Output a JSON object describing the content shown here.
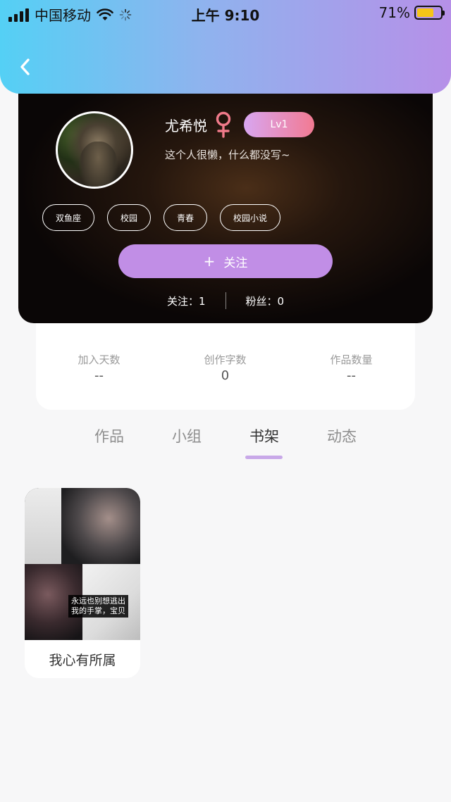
{
  "status_bar": {
    "carrier": "中国移动",
    "time": "上午 9:10",
    "battery_pct_text": "71%",
    "battery_level": 0.71
  },
  "profile": {
    "name": "尤希悦",
    "gender": "female",
    "level": "Lv1",
    "bio": "这个人很懒，什么都没写~",
    "tags": [
      "双鱼座",
      "校园",
      "青春",
      "校园小说"
    ],
    "follow_button": {
      "icon": "+",
      "label": "关注"
    },
    "following": "关注：1",
    "followers": "粉丝：0"
  },
  "stats": [
    {
      "label": "加入天数",
      "value": "--"
    },
    {
      "label": "创作字数",
      "value": "0"
    },
    {
      "label": "作品数量",
      "value": "--"
    }
  ],
  "tabs": [
    {
      "label": "作品",
      "active": false
    },
    {
      "label": "小组",
      "active": false
    },
    {
      "label": "书架",
      "active": true
    },
    {
      "label": "动态",
      "active": false
    }
  ],
  "bookshelf": [
    {
      "title": "我心有所属",
      "cover_caption_line1": "永远也别想逃出",
      "cover_caption_line2": "我的手掌，宝贝"
    }
  ],
  "colors": {
    "header_gradient_start": "#54d0f5",
    "header_gradient_end": "#b690e8",
    "follow_button": "#c18ee6",
    "level_badge_start": "#d8a6f1",
    "level_badge_end": "#f27a92",
    "gender_icon": "#f07a8a",
    "tab_underline": "#c8a8e8"
  }
}
